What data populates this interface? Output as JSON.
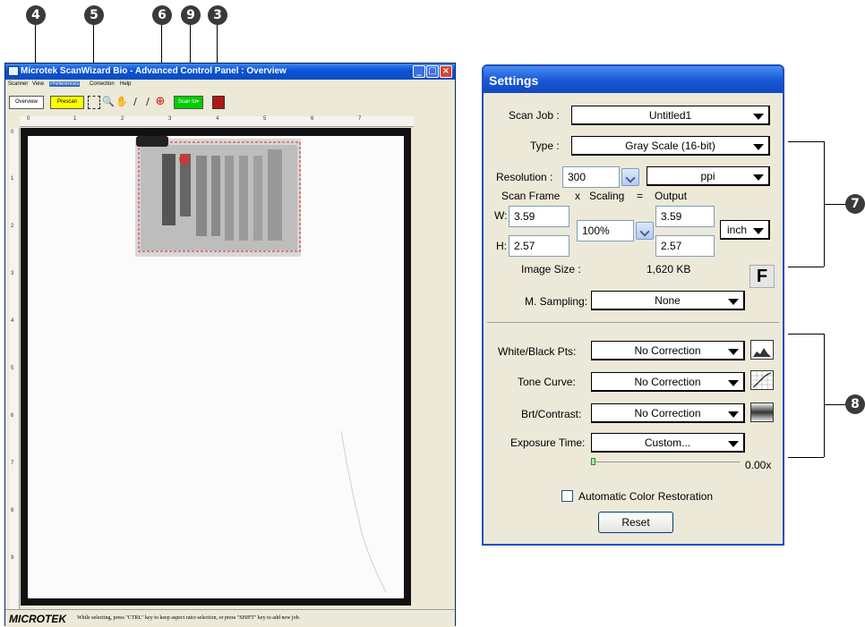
{
  "callouts": {
    "c4": "4",
    "c5": "5",
    "c6": "6",
    "c9": "9",
    "c3": "3",
    "c7": "7",
    "c8": "8"
  },
  "scanwindow": {
    "title": "Microtek ScanWizard Bio - Advanced Control Panel : Overview",
    "menu": [
      "Scanner",
      "View",
      "Preferences",
      "Correction",
      "Help"
    ],
    "toolbar": {
      "overview": "Overview",
      "prescan": "Prescan",
      "scanto": "Scan to▾"
    },
    "ruler_h": [
      "0",
      "1",
      "2",
      "3",
      "4",
      "5",
      "6",
      "7"
    ],
    "ruler_v": [
      "0",
      "1",
      "2",
      "3",
      "4",
      "5",
      "6",
      "7",
      "8",
      "9"
    ],
    "status": {
      "logo": "MICROTEK",
      "hint": "While selecting, press \"CTRL\" key to keep aspect ratio selection, or press \"SHIFT\" key to add new job."
    },
    "colors": {
      "prescan": "#ffff00",
      "scanto": "#00cc00"
    }
  },
  "settings": {
    "title": "Settings",
    "scan_job": {
      "label": "Scan Job :",
      "value": "Untitled1"
    },
    "type": {
      "label": "Type :",
      "value": "Gray Scale (16-bit)"
    },
    "resolution": {
      "label": "Resolution :",
      "value": "300",
      "unit": "ppi"
    },
    "header": {
      "frame": "Scan Frame",
      "x": "x",
      "scaling": "Scaling",
      "eq": "=",
      "output": "Output"
    },
    "w_label": "W:",
    "h_label": "H:",
    "w_in": "3.59",
    "h_in": "2.57",
    "scaling": "100%",
    "w_out": "3.59",
    "h_out": "2.57",
    "unit": "inch",
    "image_size": {
      "label": "Image Size :",
      "value": "1,620 KB"
    },
    "f_button": "F",
    "m_sampling": {
      "label": "M. Sampling:",
      "value": "None"
    },
    "white_black": {
      "label": "White/Black Pts:",
      "value": "No Correction"
    },
    "tone_curve": {
      "label": "Tone Curve:",
      "value": "No Correction"
    },
    "brt_contrast": {
      "label": "Brt/Contrast:",
      "value": "No Correction"
    },
    "exposure": {
      "label": "Exposure Time:",
      "value": "Custom...",
      "readout": "0.00x"
    },
    "auto_color": "Automatic Color Restoration",
    "reset": "Reset"
  }
}
